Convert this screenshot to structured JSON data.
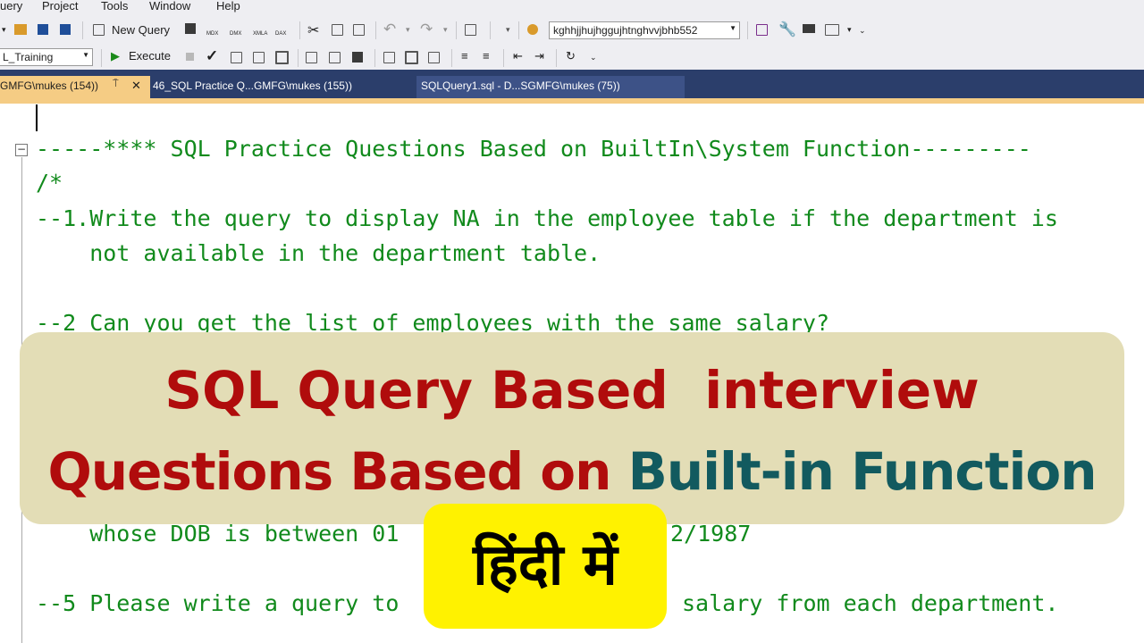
{
  "menu": [
    "uery",
    "Project",
    "Tools",
    "Window",
    "Help"
  ],
  "toolbar1": {
    "new_query": "New Query",
    "icon_labels": [
      "MDX",
      "DMX",
      "XMLA",
      "DAX"
    ],
    "search_combo": "kghhjjhujhggujhtnghvvjbhb552"
  },
  "toolbar2": {
    "db_combo": "L_Training",
    "execute": "Execute"
  },
  "tabs": {
    "active": "GMFG\\mukes (154))",
    "pin": "⍑",
    "close": "✕",
    "tab2": "46_SQL Practice Q...GMFG\\mukes (155))",
    "tab3": "SQLQuery1.sql - D...SGMFG\\mukes (75))"
  },
  "editor": {
    "lines": [
      "-----**** SQL Practice Questions Based on BuiltIn\\System Function---------",
      "/*",
      "--1.Write the query to display NA in the employee table if the department is",
      "    not available in the department table.",
      "--2 Can you get the list of employees with the same salary?",
      "    whose DOB is between 01",
      "2/1987",
      "--5 Please write a query to",
      "salary from each department."
    ]
  },
  "banner": {
    "line1": "SQL Query Based  interview",
    "line2_red": "Questions Based on ",
    "line2_teal": "Built-in Function"
  },
  "hindi_label": "हिंदी में",
  "colors": {
    "banner_red": "#b00c0c",
    "banner_teal": "#125a5f",
    "banner_bg": "#e3ddb6",
    "hindi_bg": "#fff200",
    "code_green": "#118a1c",
    "tab_strip": "#2b3e6b",
    "active_tab": "#f5cc84"
  }
}
